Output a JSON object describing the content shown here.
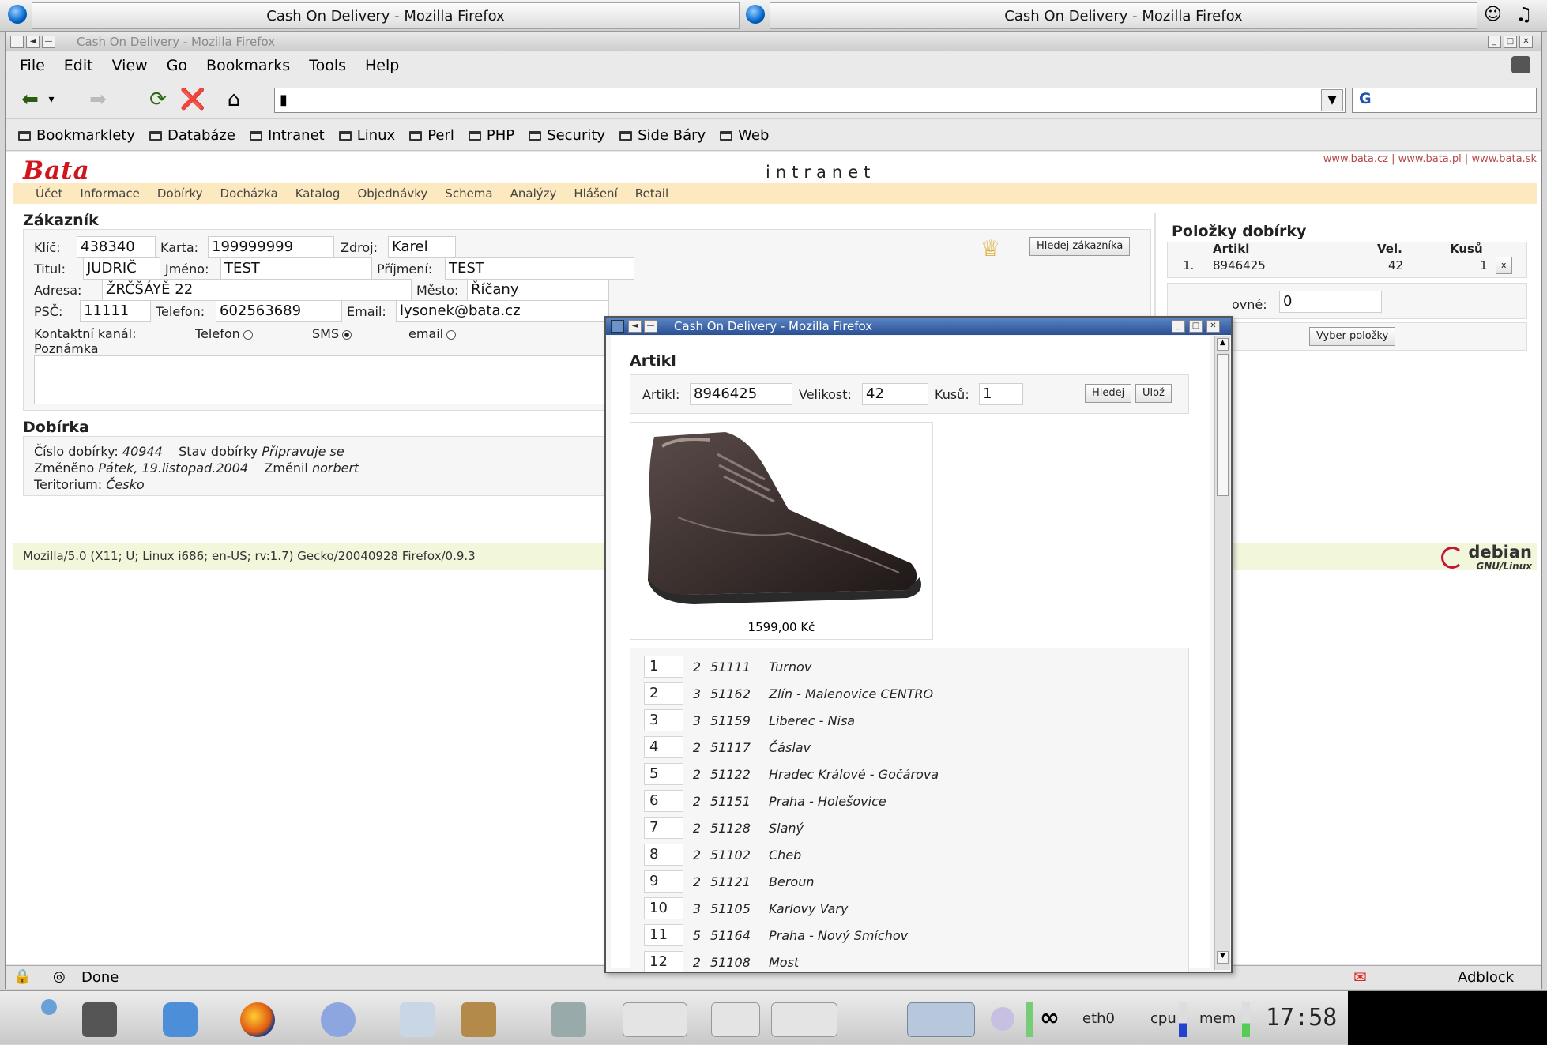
{
  "kicker": {
    "tab1_title": "Cash On Delivery - Mozilla Firefox",
    "tab2_title": "Cash On Delivery - Mozilla Firefox"
  },
  "browser": {
    "title": "Cash On Delivery - Mozilla Firefox",
    "menu": [
      "File",
      "Edit",
      "View",
      "Go",
      "Bookmarks",
      "Tools",
      "Help"
    ],
    "bookmarks": [
      "Bookmarklety",
      "Databáze",
      "Intranet",
      "Linux",
      "Perl",
      "PHP",
      "Security",
      "Side Báry",
      "Web"
    ],
    "url": "",
    "status": "Done",
    "adblock": "Adblock"
  },
  "site": {
    "logo": "Bata",
    "header": "intranet",
    "links": [
      "www.bata.cz",
      "www.bata.pl",
      "www.bata.sk"
    ],
    "links_sep": "|",
    "menu": [
      "Účet",
      "Informace",
      "Dobírky",
      "Docházka",
      "Katalog",
      "Objednávky",
      "Schema",
      "Analýzy",
      "Hlášení",
      "Retail"
    ],
    "user_agent": "Mozilla/5.0 (X11; U; Linux i686; en-US; rv:1.7) Gecko/20040928 Firefox/0.9.3",
    "debian": "debian",
    "debian_sub": "GNU/Linux"
  },
  "customer": {
    "section_title": "Zákazník",
    "key_label": "Klíč:",
    "key_value": "438340",
    "card_label": "Karta:",
    "card_value": "199999999",
    "source_label": "Zdroj:",
    "source_value": "Karel",
    "title_label": "Titul:",
    "title_value": "JUDRIČ",
    "firstname_label": "Jméno:",
    "firstname_value": "TEST",
    "lastname_label": "Příjmení:",
    "lastname_value": "TEST",
    "address_label": "Adresa:",
    "address_value": "ŽRČŠÁYĚ 22",
    "city_label": "Město:",
    "city_value": "Říčany",
    "zip_label": "PSČ:",
    "zip_value": "11111",
    "phone_label": "Telefon:",
    "phone_value": "602563689",
    "email_label": "Email:",
    "email_value": "lysonek@bata.cz",
    "channel_label": "Kontaktní kanál:",
    "channel_phone": "Telefon",
    "channel_sms": "SMS",
    "channel_email": "email",
    "note_label": "Poznámka",
    "find_button": "Hledej zákazníka"
  },
  "cod": {
    "section_title": "Dobírka",
    "number_label": "Číslo dobírky:",
    "number_value": "40944",
    "state_label": "Stav dobírky",
    "state_value": "Připravuje se",
    "changed_label": "Změněno",
    "changed_value": "Pátek, 19.listopad.2004",
    "changed_by_label": "Změnil",
    "changed_by_value": "norbert",
    "territory_label": "Teritorium:",
    "territory_value": "Česko"
  },
  "items": {
    "section_title": "Položky dobírky",
    "col_article": "Artikl",
    "col_size": "Vel.",
    "col_qty": "Kusů",
    "rows": [
      {
        "n": "1.",
        "article": "8946425",
        "size": "42",
        "qty": "1",
        "remove": "x"
      }
    ],
    "partial_label": "ovné:",
    "partial_value": "0",
    "select_button": "Vyber položky"
  },
  "popup": {
    "title": "Cash On Delivery - Mozilla Firefox",
    "heading": "Artikl",
    "article_label": "Artikl:",
    "article_value": "8946425",
    "size_label": "Velikost:",
    "size_value": "42",
    "qty_label": "Kusů:",
    "qty_value": "1",
    "find_button": "Hledej",
    "save_button": "Ulož",
    "price": "1599,00 Kč",
    "stores": [
      {
        "n": "1",
        "qty": "2",
        "code": "51111",
        "name": "Turnov"
      },
      {
        "n": "2",
        "qty": "3",
        "code": "51162",
        "name": "Zlín - Malenovice CENTRO"
      },
      {
        "n": "3",
        "qty": "3",
        "code": "51159",
        "name": "Liberec - Nisa"
      },
      {
        "n": "4",
        "qty": "2",
        "code": "51117",
        "name": "Čáslav"
      },
      {
        "n": "5",
        "qty": "2",
        "code": "51122",
        "name": "Hradec Králové - Gočárova"
      },
      {
        "n": "6",
        "qty": "2",
        "code": "51151",
        "name": "Praha - Holešovice"
      },
      {
        "n": "7",
        "qty": "2",
        "code": "51128",
        "name": "Slaný"
      },
      {
        "n": "8",
        "qty": "2",
        "code": "51102",
        "name": "Cheb"
      },
      {
        "n": "9",
        "qty": "2",
        "code": "51121",
        "name": "Beroun"
      },
      {
        "n": "10",
        "qty": "3",
        "code": "51105",
        "name": "Karlovy Vary"
      },
      {
        "n": "11",
        "qty": "5",
        "code": "51164",
        "name": "Praha - Nový Smíchov"
      },
      {
        "n": "12",
        "qty": "2",
        "code": "51108",
        "name": "Most"
      }
    ]
  },
  "taskbar": {
    "eth": "eth0",
    "cpu": "cpu",
    "mem": "mem",
    "clock": "17:58"
  }
}
